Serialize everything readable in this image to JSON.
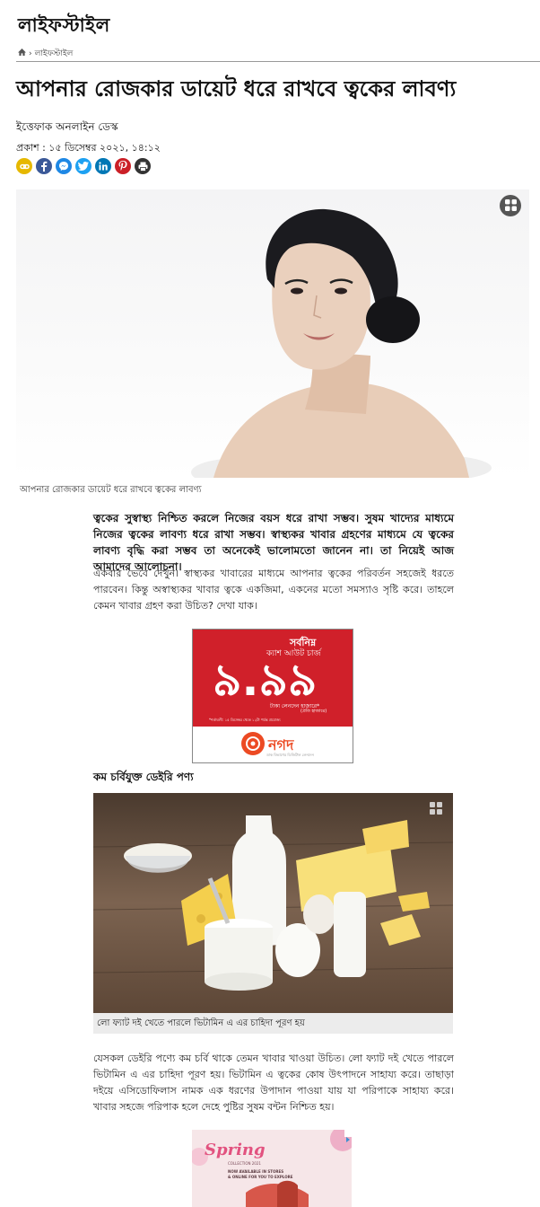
{
  "section_title": "লাইফস্টাইল",
  "breadcrumb": {
    "current": "লাইফস্টাইল",
    "separator": "›"
  },
  "headline": "আপনার রোজকার ডায়েট ধরে রাখবে ত্বকের লাবণ্য",
  "author": "ইত্তেফাক অনলাইন ডেস্ক",
  "published": "প্রকাশ : ১৫ ডিসেম্বর ২০২১, ১৪:১২",
  "share_icons": [
    "link-icon",
    "facebook-icon",
    "messenger-icon",
    "twitter-icon",
    "linkedin-icon",
    "pinterest-icon",
    "print-icon"
  ],
  "hero": {
    "caption": "আপনার রোজকার ডায়েট ধরে রাখবে ত্বকের লাবণ্য"
  },
  "lead": "ত্বকের সুস্বাস্থ্য নিশ্চিত করলে নিজের বয়স ধরে রাখা সম্ভব। সুষম খাদ্যের মাধ্যমে নিজের ত্বকের লাবণ্য ধরে রাখা সম্ভব। স্বাস্থ্যকর খাবার গ্রহণের মাধ্যমে যে ত্বকের লাবণ্য বৃদ্ধি করা সম্ভব তা অনেকেই ভালোমতো জানেন না। তা নিয়েই আজ আমাদের আলোচনা।",
  "paragraph1": "একবার ভেবে দেখুন। স্বাস্থ্যকর খাবারের মাধ্যমে আপনার ত্বকের পরিবর্তন সহজেই ধরতে পারবেন। কিন্তু অস্বাস্থ্যকর খাবার ত্বকে একজিমা, একনের মতো সমস্যাও সৃষ্টি করে। তাহলে কেমন খাবার গ্রহণ করা উচিত? দেখা যাক।",
  "ad1": {
    "tagline": "সর্বনিম্ন",
    "subtitle": "ক্যাশ আউট চার্জ",
    "rate": "৯.৯৯",
    "unit": "টাকা লেনদেন হাজারে*",
    "note": "(প্রতি হাজারে)",
    "fineprint": "*শর্তাবলী: ১৫ ডিসেম্বর থেকে ১২টা পর্যন্ত প্রযোজ্য",
    "brand": "নগদ",
    "brand_tag": "ডাক বিভাগের ডিজিটাল লেনদেন",
    "colors": {
      "red": "#d0202a",
      "orange": "#ec4a23"
    }
  },
  "subheading": "কম চর্বিযুক্ত ডেইরি পণ্য",
  "dairy": {
    "caption": "লো ফ্যাট দই খেতে পারলে ভিটামিন এ এর চাহিদা পূরণ হয়"
  },
  "paragraph2": "যেসকল ডেইরি পণ্যে কম চর্বি থাকে তেমন খাবার খাওয়া উচিত। লো ফ্যাট দই খেতে পারলে ভিটামিন এ এর চাহিদা পূরণ হয়। ভিটামিন এ ত্বকের কোষ উৎপাদনে সাহায্য করে। তাছাড়া দইয়ে এসিডোফিলাস নামক এক ধরণের উপাদান পাওয়া যায় যা পরিপাকে সাহায্য করে। খাবার সহজে পরিপাক হলে দেহে পুষ্টির সুষম বন্টন নিশ্চিত হয়।",
  "ad2": {
    "title": "Spring",
    "subtitle": "COLLECTION 2021",
    "line1": "NOW AVAILABLE IN STORES",
    "line2": "& ONLINE FOR YOU TO EXPLORE"
  }
}
